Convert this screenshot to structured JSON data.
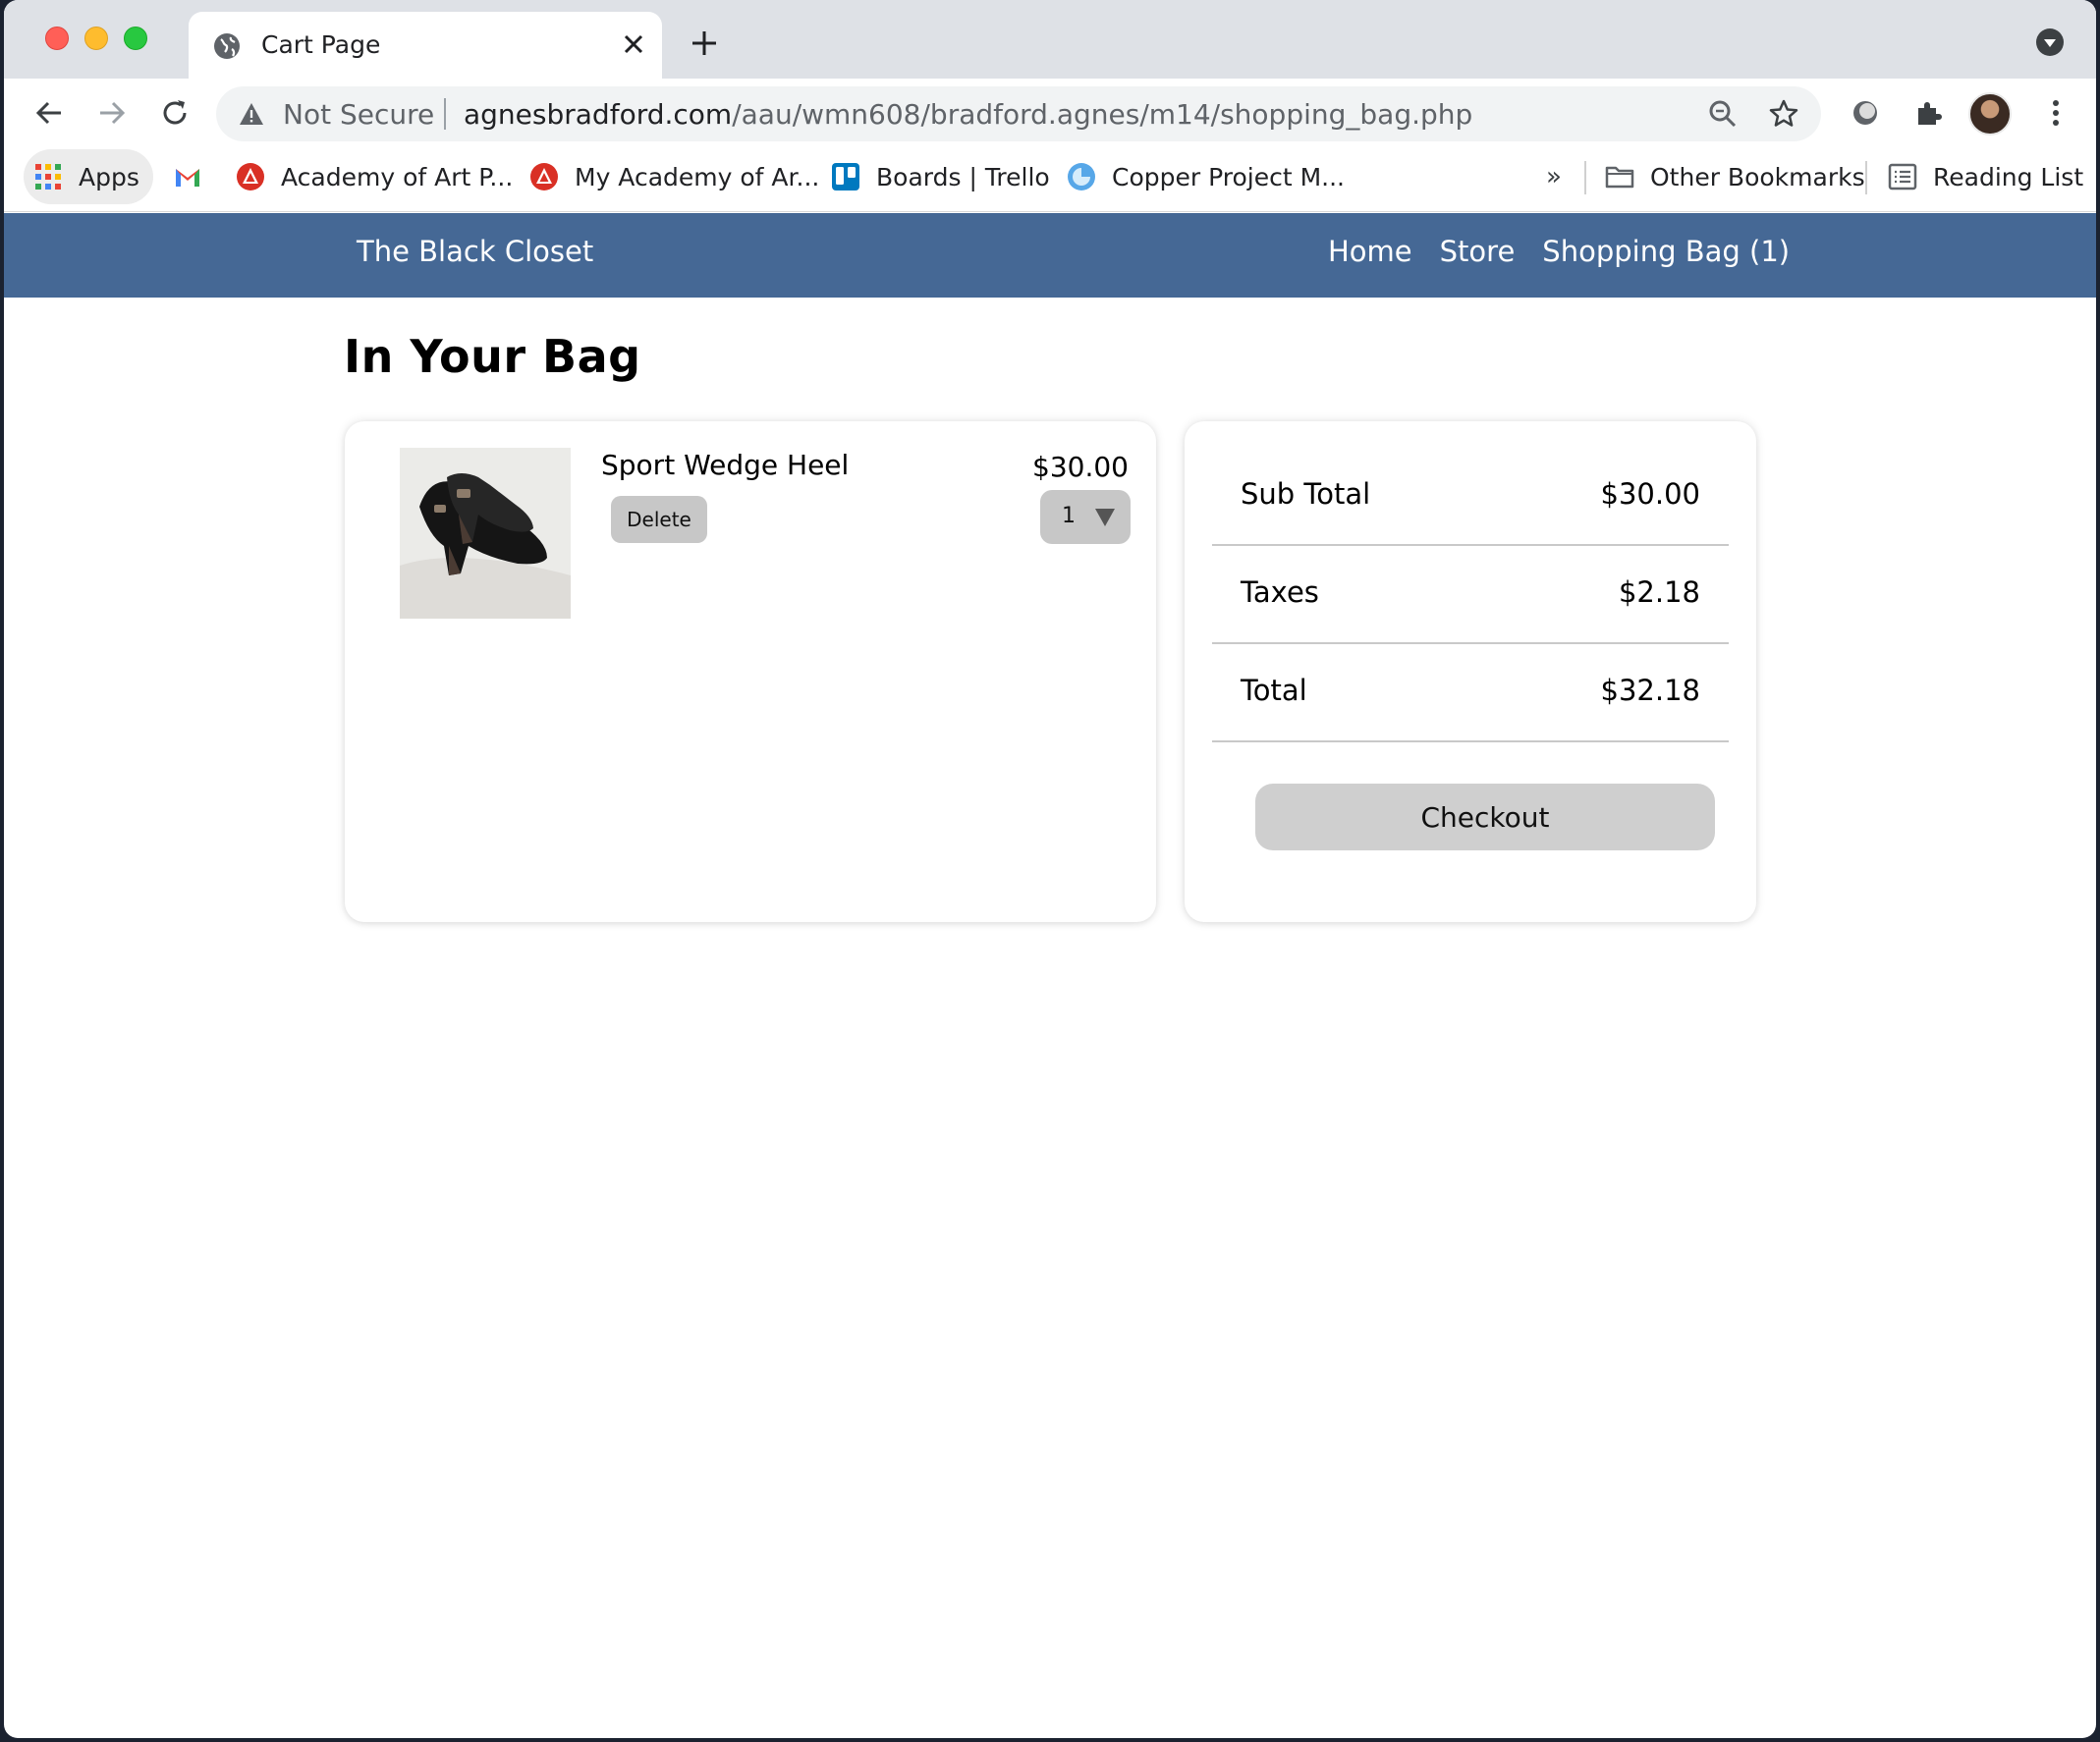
{
  "browser": {
    "tab_title": "Cart Page",
    "security_label": "Not Secure",
    "url_host": "agnesbradford.com",
    "url_path": "/aau/wmn608/bradford.agnes/m14/shopping_bag.php",
    "bookmarks": {
      "apps": "Apps",
      "academy_1": "Academy of Art P...",
      "academy_2": "My Academy of Ar...",
      "trello": "Boards | Trello",
      "copper": "Copper Project M...",
      "more": "»",
      "other": "Other Bookmarks",
      "reading": "Reading List"
    }
  },
  "site": {
    "brand": "The Black Closet",
    "nav": {
      "home": "Home",
      "store": "Store",
      "bag": "Shopping Bag (1)"
    },
    "accent_color": "#456895"
  },
  "cart": {
    "title": "In Your Bag",
    "items": [
      {
        "name": "Sport Wedge Heel",
        "price": "$30.00",
        "quantity": "1",
        "delete_label": "Delete"
      }
    ]
  },
  "summary": {
    "subtotal_label": "Sub Total",
    "subtotal_value": "$30.00",
    "taxes_label": "Taxes",
    "taxes_value": "$2.18",
    "total_label": "Total",
    "total_value": "$32.18",
    "checkout_label": "Checkout"
  }
}
